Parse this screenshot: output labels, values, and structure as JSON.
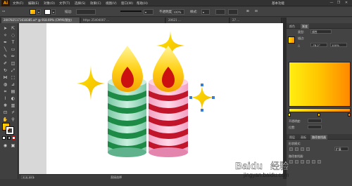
{
  "app": {
    "logo": "Ai",
    "menus": [
      "文件(F)",
      "编辑(E)",
      "对象(O)",
      "文字(T)",
      "选择(S)",
      "效果(C)",
      "视图(V)",
      "窗口(W)",
      "帮助(H)"
    ],
    "workspace": "基本功能",
    "window_buttons": [
      "—",
      "❐",
      "✕"
    ]
  },
  "control_bar": {
    "fill_color": "#ffcc00",
    "stroke_color": "#ffffff",
    "stroke_label": "描边:",
    "opacity_label": "不透明度:",
    "opacity_value": "100%",
    "style_label": "样式:"
  },
  "tabs": [
    {
      "label": "2007825171618385.ai* @ 918.69% (CMYK/预览)",
      "active": true
    },
    {
      "label": "https 25404007 ...",
      "active": false
    },
    {
      "label": "20621 ...",
      "active": false
    },
    {
      "label": "27 ...",
      "active": false
    }
  ],
  "toolbar": {
    "tools": [
      "selection-tool",
      "direct-selection-tool",
      "magic-wand-tool",
      "lasso-tool",
      "pen-tool",
      "type-tool",
      "line-tool",
      "rectangle-tool",
      "paintbrush-tool",
      "pencil-tool",
      "blob-brush-tool",
      "eraser-tool",
      "rotate-tool",
      "scale-tool",
      "width-tool",
      "free-transform-tool",
      "shape-builder-tool",
      "perspective-tool",
      "mesh-tool",
      "gradient-tool",
      "eyedropper-tool",
      "blend-tool",
      "symbol-sprayer-tool",
      "column-graph-tool",
      "artboard-tool",
      "slice-tool",
      "hand-tool",
      "zoom-tool"
    ],
    "fill_gradient_start": "#ffe000",
    "fill_gradient_end": "#ff9000"
  },
  "status_bar": {
    "zoom": "918.69%",
    "status": "直接选择"
  },
  "right_panel": {
    "tabs": [
      "颜色",
      "渐变"
    ],
    "type_label": "类型:",
    "type_value": "线性",
    "stroke_label": "描边:",
    "angle_label": "△",
    "angle_value": "-78.2°",
    "aspect_value": "100%",
    "opacity_label": "不透明度:",
    "location_label": "位置:",
    "gradient_start": "#ffee10",
    "gradient_mid": "#ffc400",
    "gradient_end": "#ff8800",
    "lower_tabs": [
      "图层",
      "画板",
      "路径查找器"
    ],
    "shape_modes_label": "形状模式:",
    "pathfinder_label": "路径查找器:",
    "expand_button": "扩展"
  },
  "watermark": {
    "brand": "Baidu",
    "brand_cn": "经验",
    "url": "jingyan.baidu.com"
  }
}
